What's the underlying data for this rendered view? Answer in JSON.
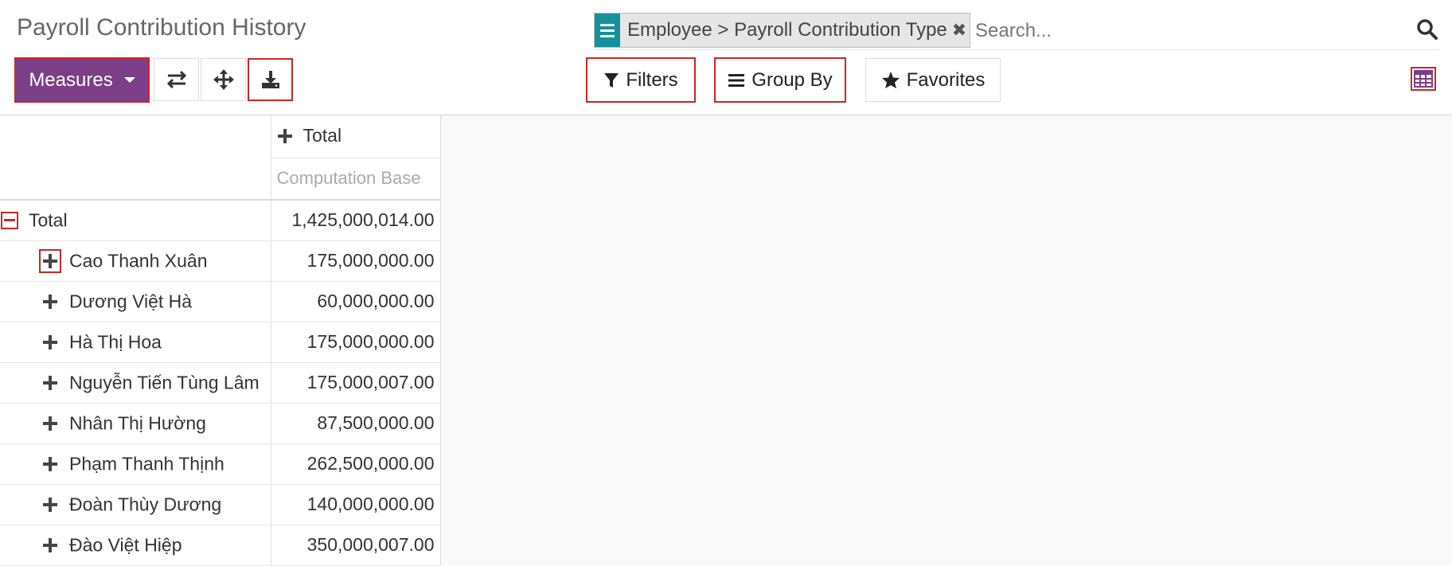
{
  "page": {
    "title": "Payroll Contribution History"
  },
  "search": {
    "facet_label": "Employee  > Payroll Contribution Type",
    "facet_close": "✖",
    "placeholder": "Search..."
  },
  "toolbar": {
    "measures_label": "Measures",
    "filters_label": "Filters",
    "group_by_label": "Group By",
    "favorites_label": "Favorites"
  },
  "pivot": {
    "column_header": "Total",
    "measure_header": "Computation Base",
    "total_row": {
      "label": "Total",
      "value": "1,425,000,014.00"
    },
    "rows": [
      {
        "label": "Cao Thanh Xuân",
        "value": "175,000,000.00"
      },
      {
        "label": "Dương Việt Hà",
        "value": "60,000,000.00"
      },
      {
        "label": "Hà Thị Hoa",
        "value": "175,000,000.00"
      },
      {
        "label": "Nguyễn Tiến Tùng Lâm",
        "value": "175,000,007.00"
      },
      {
        "label": "Nhân Thị Hường",
        "value": "87,500,000.00"
      },
      {
        "label": "Phạm Thanh Thịnh",
        "value": "262,500,000.00"
      },
      {
        "label": "Đoàn Thùy Dương",
        "value": "140,000,000.00"
      },
      {
        "label": "Đào Việt Hiệp",
        "value": "350,000,007.00"
      }
    ]
  },
  "colors": {
    "primary": "#7c3e86",
    "facet": "#14919b",
    "highlight": "#c62828"
  },
  "icons": [
    "facet-list-icon",
    "search-icon",
    "flip-axis-icon",
    "expand-all-icon",
    "download-icon",
    "filter-icon",
    "group-by-icon",
    "star-icon",
    "pivot-view-icon",
    "collapse-icon",
    "expand-icon"
  ]
}
